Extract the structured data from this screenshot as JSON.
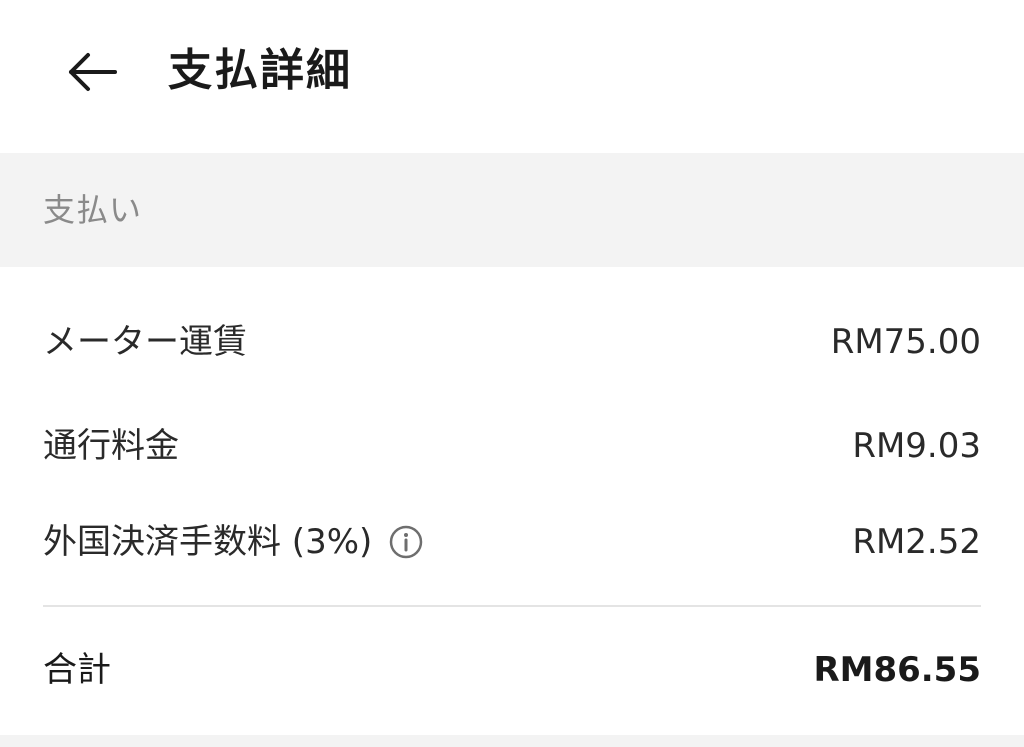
{
  "header": {
    "back_icon": "arrow-left-icon",
    "title": "支払詳細"
  },
  "section": {
    "label": "支払い"
  },
  "items": [
    {
      "label": "メーター運賃",
      "value": "RM75.00"
    },
    {
      "label": "通行料金",
      "value": "RM9.03"
    },
    {
      "label": "外国決済手数料 (3%)",
      "value": "RM2.52",
      "icon": "info-icon"
    }
  ],
  "total": {
    "label": "合計",
    "value": "RM86.55"
  },
  "colors": {
    "section_bg": "#f3f3f3",
    "section_text": "#8a8a8a",
    "text": "#2a2a2a",
    "divider": "#e4e4e4"
  }
}
